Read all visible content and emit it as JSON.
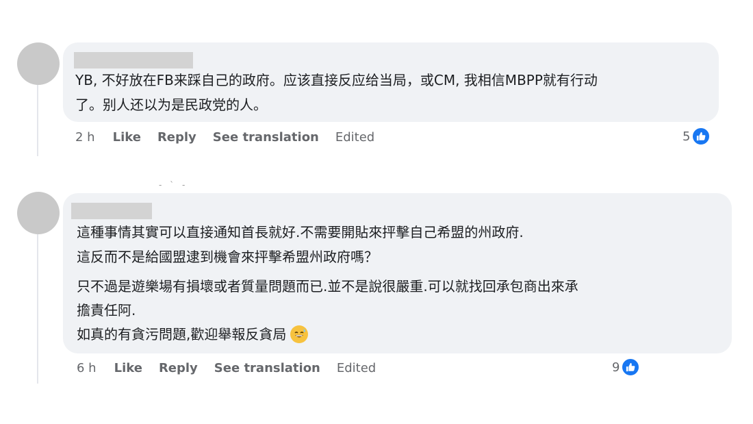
{
  "comments": [
    {
      "lines": [
        "YB, 不好放在FB来踩自己的政府。应该直接反应给当局，或CM, 我相信MBPP就有行动",
        "了。别人还以为是民政党的人。"
      ],
      "time": "2 h",
      "like_label": "Like",
      "reply_label": "Reply",
      "translate_label": "See translation",
      "edited_label": "Edited",
      "reaction_count": "5",
      "reaction_icon": "like-icon",
      "accent": "#1877f2"
    },
    {
      "lines": [
        "這種事情其實可以直接通知首長就好.不需要開貼來抨擊自己希盟的州政府.",
        "這反而不是給國盟逮到機會來抨擊希盟州政府嗎？",
        "只不過是遊樂場有損壞或者質量問題而已.並不是說很嚴重.可以就找回承包商出來承",
        "擔責任阿.",
        "如真的有貪污問題,歡迎舉報反貪局"
      ],
      "emoji": "grinning-sweat-emoji",
      "time": "6 h",
      "like_label": "Like",
      "reply_label": "Reply",
      "translate_label": "See translation",
      "edited_label": "Edited",
      "reaction_count": "9",
      "reaction_icon": "like-icon",
      "accent": "#1877f2"
    }
  ]
}
